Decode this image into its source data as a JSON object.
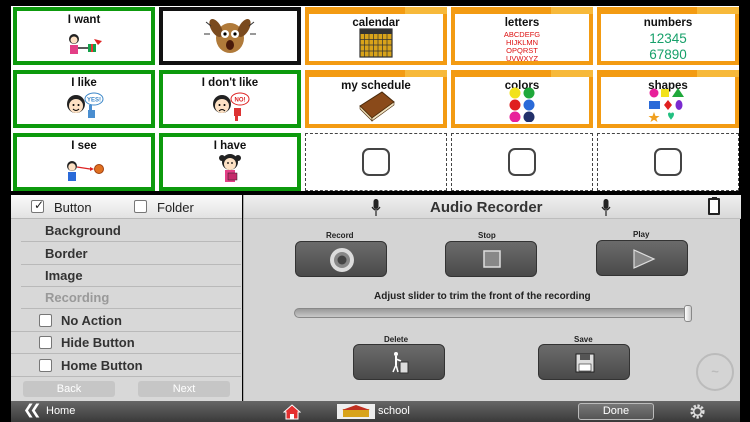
{
  "tiles": [
    {
      "label": "I want",
      "style": "green"
    },
    {
      "label": "",
      "style": "black"
    },
    {
      "label": "calendar",
      "style": "folder"
    },
    {
      "label": "letters",
      "style": "folder",
      "text_lines": [
        "ABCDEFG",
        "HIJKLMN",
        "OPQRST",
        "UVWXYZ"
      ]
    },
    {
      "label": "numbers",
      "style": "folder",
      "text_lines": [
        "12345",
        "67890"
      ]
    },
    {
      "label": "I like",
      "style": "green",
      "bubble": "YES!"
    },
    {
      "label": "I don't like",
      "style": "green",
      "bubble": "NO!"
    },
    {
      "label": "my schedule",
      "style": "folder"
    },
    {
      "label": "colors",
      "style": "folder"
    },
    {
      "label": "shapes",
      "style": "folder"
    },
    {
      "label": "I see",
      "style": "green"
    },
    {
      "label": "I have",
      "style": "green"
    },
    {
      "label": "",
      "style": "empty"
    },
    {
      "label": "",
      "style": "empty"
    },
    {
      "label": "",
      "style": "empty"
    }
  ],
  "left_panel": {
    "button_label": "Button",
    "folder_label": "Folder",
    "button_checked": true,
    "folder_checked": false,
    "menu": [
      "Background",
      "Border",
      "Image",
      "Recording"
    ],
    "options": [
      "No Action",
      "Hide Button",
      "Home Button"
    ],
    "back": "Back",
    "next": "Next"
  },
  "recorder": {
    "title": "Audio Recorder",
    "record": "Record",
    "stop": "Stop",
    "play": "Play",
    "slider_caption": "Adjust slider to trim the front of the recording",
    "slider_value": 1.0,
    "delete": "Delete",
    "save": "Save"
  },
  "statusbar": {
    "home": "Home",
    "school": "school",
    "done": "Done"
  },
  "colors": {
    "green_border": "#0d9a0d",
    "folder_orange": "#f39b12",
    "panel_gray": "#d4d4d4"
  }
}
